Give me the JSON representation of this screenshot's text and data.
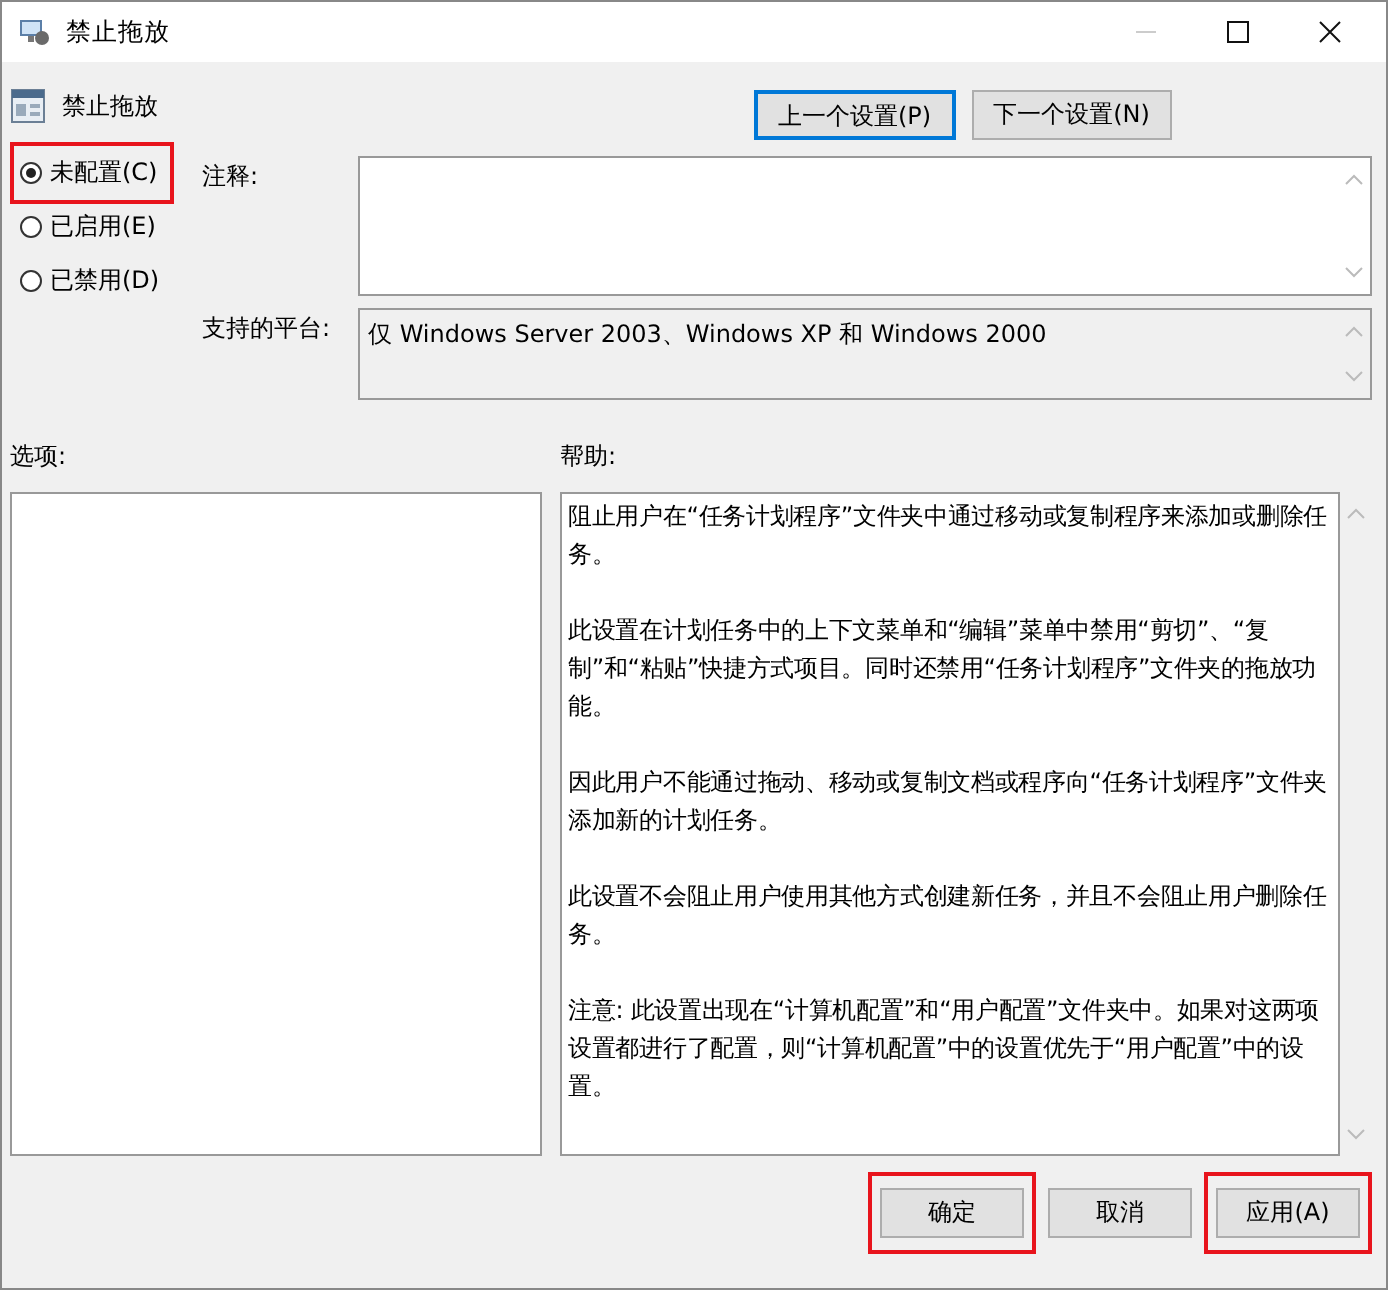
{
  "window": {
    "title": "禁止拖放"
  },
  "setting_title": "禁止拖放",
  "nav_buttons": [
    {
      "label": "上一个设置(P)",
      "focused": true
    },
    {
      "label": "下一个设置(N)",
      "focused": false
    }
  ],
  "states": [
    {
      "label": "未配置(C)",
      "selected": true,
      "highlighted": true
    },
    {
      "label": "已启用(E)",
      "selected": false,
      "highlighted": false
    },
    {
      "label": "已禁用(D)",
      "selected": false,
      "highlighted": false
    }
  ],
  "comment": {
    "label": "注释:"
  },
  "platform": {
    "label": "支持的平台:",
    "value": "仅 Windows Server 2003、Windows XP 和 Windows 2000"
  },
  "options": {
    "label": "选项:"
  },
  "help": {
    "label": "帮助:",
    "paragraphs": [
      "阻止用户在“任务计划程序”文件夹中通过移动或复制程序来添加或删除任务。",
      "此设置在计划任务中的上下文菜单和“编辑”菜单中禁用“剪切”、“复制”和“粘贴”快捷方式项目。同时还禁用“任务计划程序”文件夹的拖放功能。",
      "因此用户不能通过拖动、移动或复制文档或程序向“任务计划程序”文件夹添加新的计划任务。",
      "此设置不会阻止用户使用其他方式创建新任务，并且不会阻止用户删除任务。",
      "注意: 此设置出现在“计算机配置”和“用户配置”文件夹中。如果对这两项设置都进行了配置，则“计算机配置”中的设置优先于“用户配置”中的设置。"
    ]
  },
  "buttons": [
    {
      "label": "确定",
      "highlighted": true
    },
    {
      "label": "取消",
      "highlighted": false
    },
    {
      "label": "应用(A)",
      "highlighted": true
    }
  ]
}
